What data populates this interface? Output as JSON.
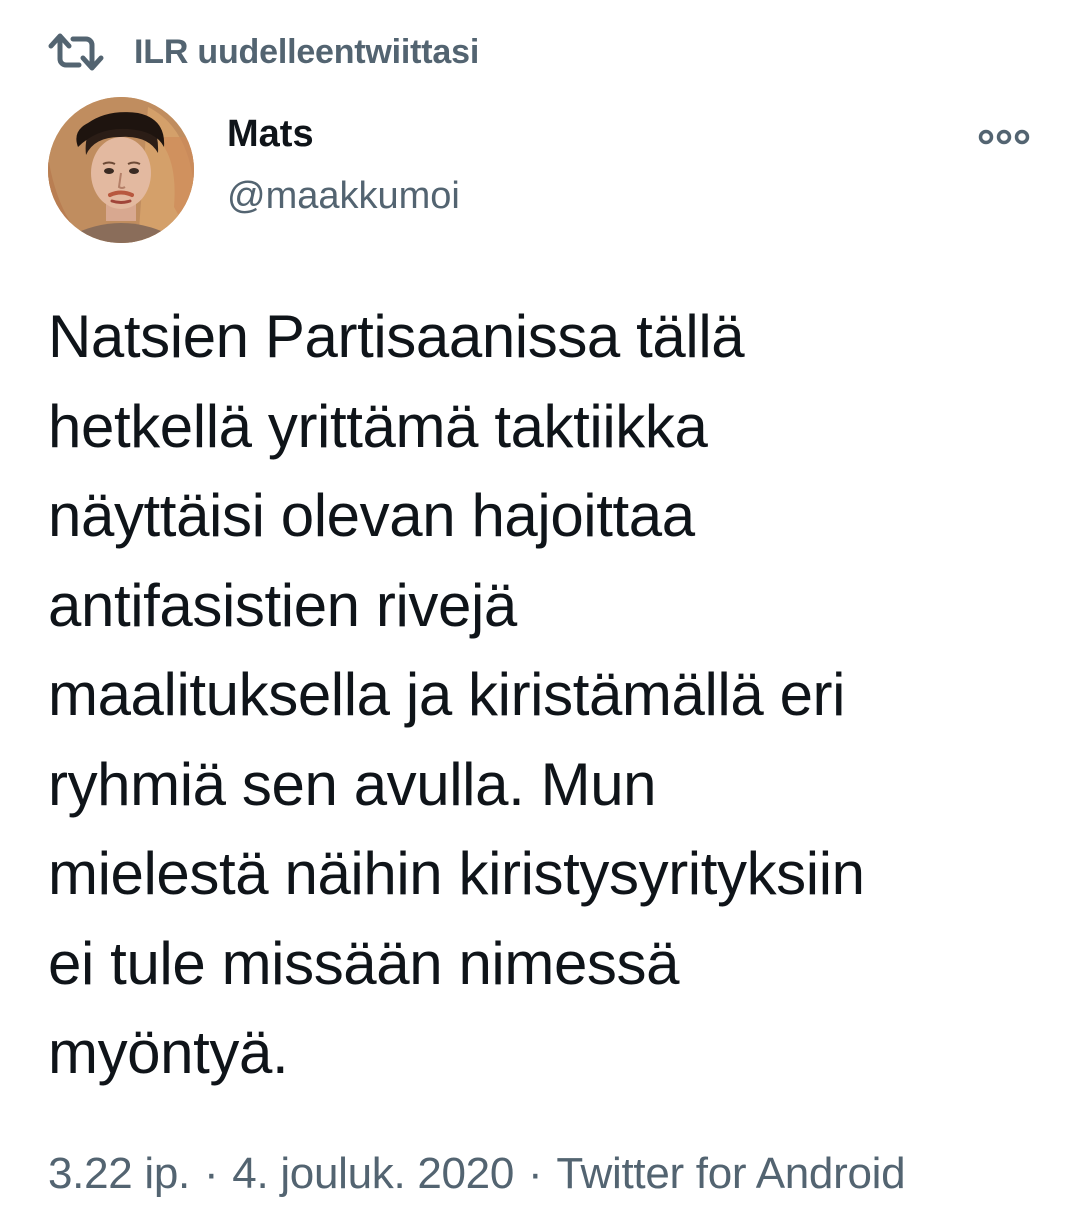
{
  "retweet": {
    "icon": "retweet-icon",
    "label": "ILR uudelleentwiittasi"
  },
  "author": {
    "avatar_icon": "avatar-portrait",
    "name": "Mats",
    "handle": "@maakkumoi"
  },
  "more": {
    "icon": "more-options-icon"
  },
  "tweet": {
    "lines": [
      "Natsien Partisaanissa tällä",
      "hetkellä yrittämä taktiikka",
      "näyttäisi olevan hajoittaa",
      "antifasistien rivejä",
      "maalituksella ja kiristämällä eri",
      "ryhmiä sen avulla. Mun",
      "mielestä näihin kiristysyrityksiin",
      "ei tule missään nimessä",
      "myöntyä."
    ]
  },
  "meta": {
    "time": "3.22 ip.",
    "date": "4. jouluk. 2020",
    "source": "Twitter for Android",
    "separator": "·"
  },
  "colors": {
    "text_primary": "#0f1419",
    "text_secondary": "#536471",
    "background": "#ffffff"
  }
}
